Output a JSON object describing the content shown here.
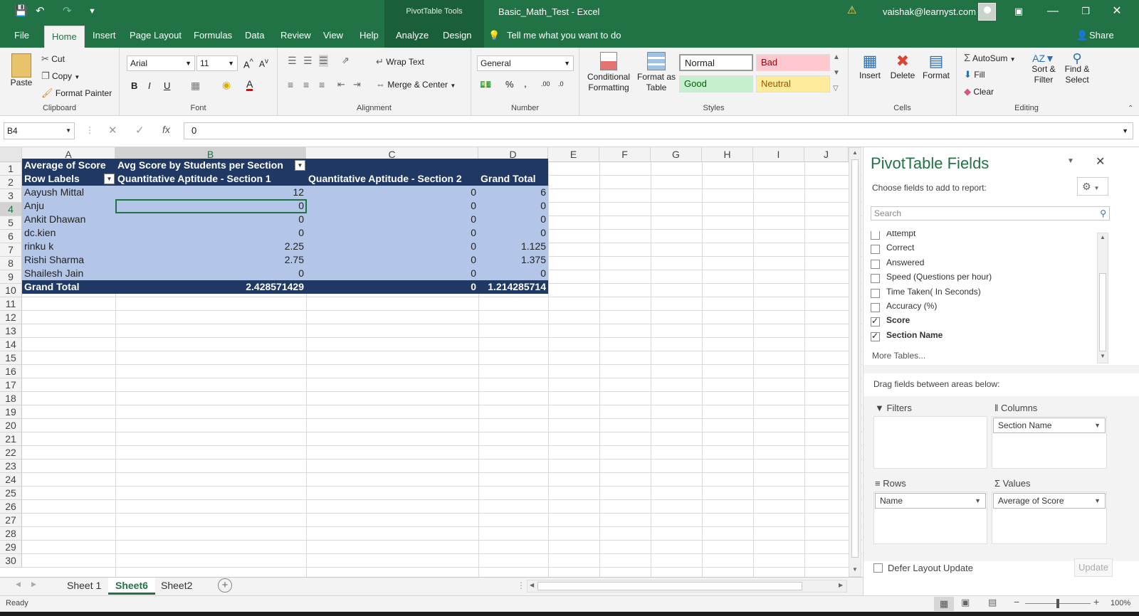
{
  "titlebar": {
    "context_tab": "PivotTable Tools",
    "document": "Basic_Math_Test  -  Excel",
    "user": "vaishak@learnyst.com"
  },
  "ribbon_tabs": [
    "File",
    "Home",
    "Insert",
    "Page Layout",
    "Formulas",
    "Data",
    "Review",
    "View",
    "Help",
    "Analyze",
    "Design"
  ],
  "tell_me": "Tell me what you want to do",
  "share": "Share",
  "clipboard": {
    "paste": "Paste",
    "cut": "Cut",
    "copy": "Copy",
    "format_painter": "Format Painter",
    "label": "Clipboard"
  },
  "font": {
    "name": "Arial",
    "size": "11",
    "label": "Font",
    "bold": "B",
    "italic": "I",
    "underline": "U"
  },
  "alignment": {
    "wrap": "Wrap Text",
    "merge": "Merge & Center",
    "label": "Alignment"
  },
  "number": {
    "format": "General",
    "percent": "%",
    "label": "Number"
  },
  "styles": {
    "conditional": "Conditional Formatting",
    "format_table": "Format as Table",
    "normal": "Normal",
    "bad": "Bad",
    "good": "Good",
    "neutral": "Neutral",
    "label": "Styles"
  },
  "cells_group": {
    "insert": "Insert",
    "delete": "Delete",
    "format": "Format",
    "label": "Cells"
  },
  "editing": {
    "autosum": "AutoSum",
    "fill": "Fill",
    "clear": "Clear",
    "sort": "Sort & Filter",
    "find": "Find & Select",
    "label": "Editing"
  },
  "formula_bar": {
    "name_box": "B4",
    "fx": "fx",
    "value": "0"
  },
  "columns": [
    "A",
    "B",
    "C",
    "D",
    "E",
    "F",
    "G",
    "H",
    "I",
    "J"
  ],
  "rows": [
    "1",
    "2",
    "3",
    "4",
    "5",
    "6",
    "7",
    "8",
    "9",
    "10",
    "11",
    "12",
    "13",
    "14",
    "15",
    "16",
    "17",
    "18",
    "19",
    "20",
    "21",
    "22",
    "23",
    "24",
    "25",
    "26",
    "27",
    "28",
    "29",
    "30"
  ],
  "pivot": {
    "a1": "Average of Score",
    "b1": "Avg Score by Students per Section",
    "header_row": [
      "Row Labels",
      "Quantitative Aptitude - Section 1",
      "Quantitative Aptitude - Section 2",
      "Grand Total"
    ],
    "data": [
      [
        "Aayush Mittal",
        "12",
        "0",
        "6"
      ],
      [
        "Anju",
        "0",
        "0",
        "0"
      ],
      [
        "Ankit Dhawan",
        "0",
        "0",
        "0"
      ],
      [
        "dc.kien",
        "0",
        "0",
        "0"
      ],
      [
        "rinku k",
        "2.25",
        "0",
        "1.125"
      ],
      [
        "Rishi Sharma",
        "2.75",
        "0",
        "1.375"
      ],
      [
        "Shailesh Jain",
        "0",
        "0",
        "0"
      ]
    ],
    "grand_total": [
      "Grand Total",
      "2.428571429",
      "0",
      "1.214285714"
    ]
  },
  "sheets": [
    "Sheet 1",
    "Sheet6",
    "Sheet2"
  ],
  "status": {
    "ready": "Ready",
    "zoom": "100%"
  },
  "pane": {
    "title": "PivotTable Fields",
    "choose": "Choose fields to add to report:",
    "search_placeholder": "Search",
    "fields": [
      {
        "label": "Attempt",
        "checked": false
      },
      {
        "label": "Correct",
        "checked": false
      },
      {
        "label": "Answered",
        "checked": false
      },
      {
        "label": "Speed (Questions per hour)",
        "checked": false
      },
      {
        "label": "Time Taken( In Seconds)",
        "checked": false
      },
      {
        "label": "Accuracy (%)",
        "checked": false
      },
      {
        "label": "Score",
        "checked": true
      },
      {
        "label": "Section Name",
        "checked": true
      }
    ],
    "more_tables": "More Tables...",
    "drag_hint": "Drag fields between areas below:",
    "filters": "Filters",
    "columns": "Columns",
    "columns_item": "Section Name",
    "rows": "Rows",
    "rows_item": "Name",
    "values": "Values",
    "values_item": "Average of Score",
    "defer": "Defer Layout Update",
    "update": "Update"
  },
  "colors": {
    "excel_green": "#217346",
    "pivot_dark": "#1f3864",
    "pivot_light": "#b4c6e7"
  }
}
